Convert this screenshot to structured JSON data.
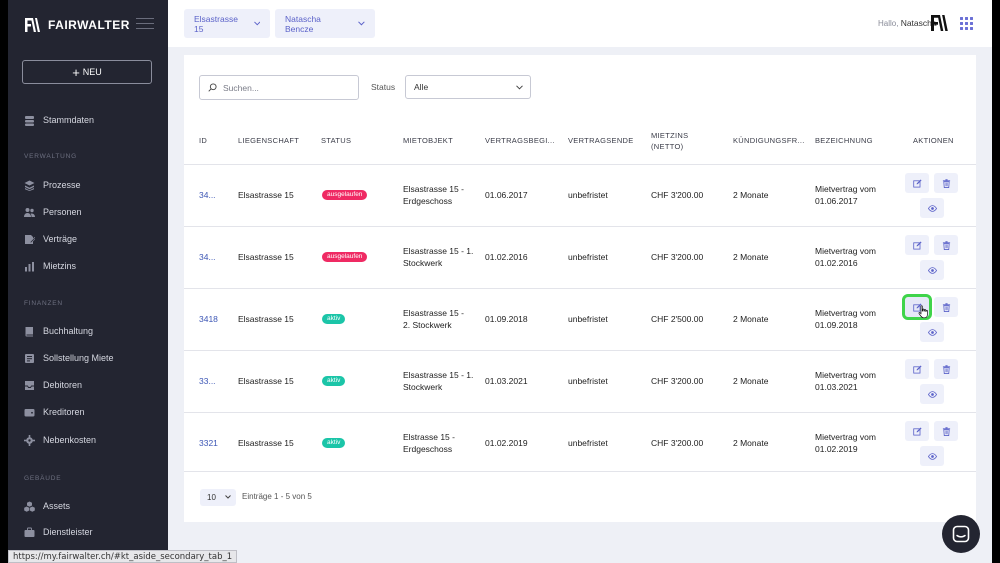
{
  "browser": {
    "status_url": "https://my.fairwalter.ch/#kt_aside_secondary_tab_1"
  },
  "sidebar": {
    "brand": "FAIRWALTER",
    "new_button": "NEU",
    "items": [
      {
        "label": "Stammdaten",
        "icon": "database-icon"
      },
      {
        "section": "VERWALTUNG"
      },
      {
        "label": "Prozesse",
        "icon": "layers-icon"
      },
      {
        "label": "Personen",
        "icon": "users-icon"
      },
      {
        "label": "Verträge",
        "icon": "contract-icon"
      },
      {
        "label": "Mietzins",
        "icon": "chart-icon"
      },
      {
        "section": "FINANZEN"
      },
      {
        "label": "Buchhaltung",
        "icon": "book-icon"
      },
      {
        "label": "Sollstellung Miete",
        "icon": "list-icon"
      },
      {
        "label": "Debitoren",
        "icon": "inbox-icon"
      },
      {
        "label": "Kreditoren",
        "icon": "wallet-icon"
      },
      {
        "label": "Nebenkosten",
        "icon": "gear-icon"
      },
      {
        "section": "GEBÄUDE"
      },
      {
        "label": "Assets",
        "icon": "cubes-icon"
      },
      {
        "label": "Dienstleister",
        "icon": "briefcase-icon"
      }
    ]
  },
  "header": {
    "property_select": "Elsastrasse 15",
    "person_select": "Natascha Bencze",
    "greeting": "Hallo,",
    "user_name": "Natascha"
  },
  "filters": {
    "search_placeholder": "Suchen...",
    "status_label": "Status",
    "status_value": "Alle"
  },
  "table": {
    "columns": [
      "ID",
      "LIEGENSCHAFT",
      "STATUS",
      "MIETOBJEKT",
      "VERTRAGSBEGINN",
      "VERTRAGSENDE",
      "MIETZINS (NETTO)",
      "KÜNDIGUNGSFRIST",
      "BEZEICHNUNG",
      "AKTIONEN"
    ],
    "columns_display": [
      "ID",
      "LIEGENSCHAFT",
      "STATUS",
      "MIETOBJEKT",
      "VERTRAGSBEGI...",
      "VERTRAGSENDE",
      "MIETZINS",
      "KÜNDIGUNGSFR...",
      "BEZEICHNUNG",
      "AKTIONEN"
    ],
    "column_sub": {
      "mietzins": "(NETTO)"
    },
    "rows": [
      {
        "id": "34...",
        "liegenschaft": "Elsastrasse 15",
        "status": "ausgelaufen",
        "status_color": "#ef2a63",
        "objekt_1": "Elsastrasse 15 -",
        "objekt_2": "Erdgeschoss",
        "beginn": "01.06.2017",
        "ende": "unbefristet",
        "mietzins": "CHF 3'200.00",
        "frist": "2 Monate",
        "bez_1": "Mietvertrag vom",
        "bez_2": "01.06.2017"
      },
      {
        "id": "34...",
        "liegenschaft": "Elsastrasse 15",
        "status": "ausgelaufen",
        "status_color": "#ef2a63",
        "objekt_1": "Elsastrasse 15 - 1.",
        "objekt_2": "Stockwerk",
        "beginn": "01.02.2016",
        "ende": "unbefristet",
        "mietzins": "CHF 3'200.00",
        "frist": "2 Monate",
        "bez_1": "Mietvertrag vom",
        "bez_2": "01.02.2016"
      },
      {
        "id": "3418",
        "liegenschaft": "Elsastrasse 15",
        "status": "aktiv",
        "status_color": "#1bc5a8",
        "objekt_1": "Elsastrasse 15 -",
        "objekt_2": "2. Stockwerk",
        "beginn": "01.09.2018",
        "ende": "unbefristet",
        "mietzins": "CHF 2'500.00",
        "frist": "2 Monate",
        "bez_1": "Mietvertrag vom",
        "bez_2": "01.09.2018"
      },
      {
        "id": "33...",
        "liegenschaft": "Elsastrasse 15",
        "status": "aktiv",
        "status_color": "#1bc5a8",
        "objekt_1": "Elsastrasse 15 - 1.",
        "objekt_2": "Stockwerk",
        "beginn": "01.03.2021",
        "ende": "unbefristet",
        "mietzins": "CHF 3'200.00",
        "frist": "2 Monate",
        "bez_1": "Mietvertrag vom",
        "bez_2": "01.03.2021"
      },
      {
        "id": "3321",
        "liegenschaft": "Elsastrasse 15",
        "status": "aktiv",
        "status_color": "#1bc5a8",
        "objekt_1": "Elstrasse 15 -",
        "objekt_2": "Erdgeschoss",
        "beginn": "01.02.2019",
        "ende": "unbefristet",
        "mietzins": "CHF 3'200.00",
        "frist": "2 Monate",
        "bez_1": "Mietvertrag vom",
        "bez_2": "01.02.2019"
      }
    ]
  },
  "pagination": {
    "page_size": "10",
    "entries_text": "Einträge 1 - 5 von 5"
  },
  "colors": {
    "accent": "#5b62c9",
    "sidebar_bg": "#232531",
    "focus_ring": "#3fd44a"
  }
}
